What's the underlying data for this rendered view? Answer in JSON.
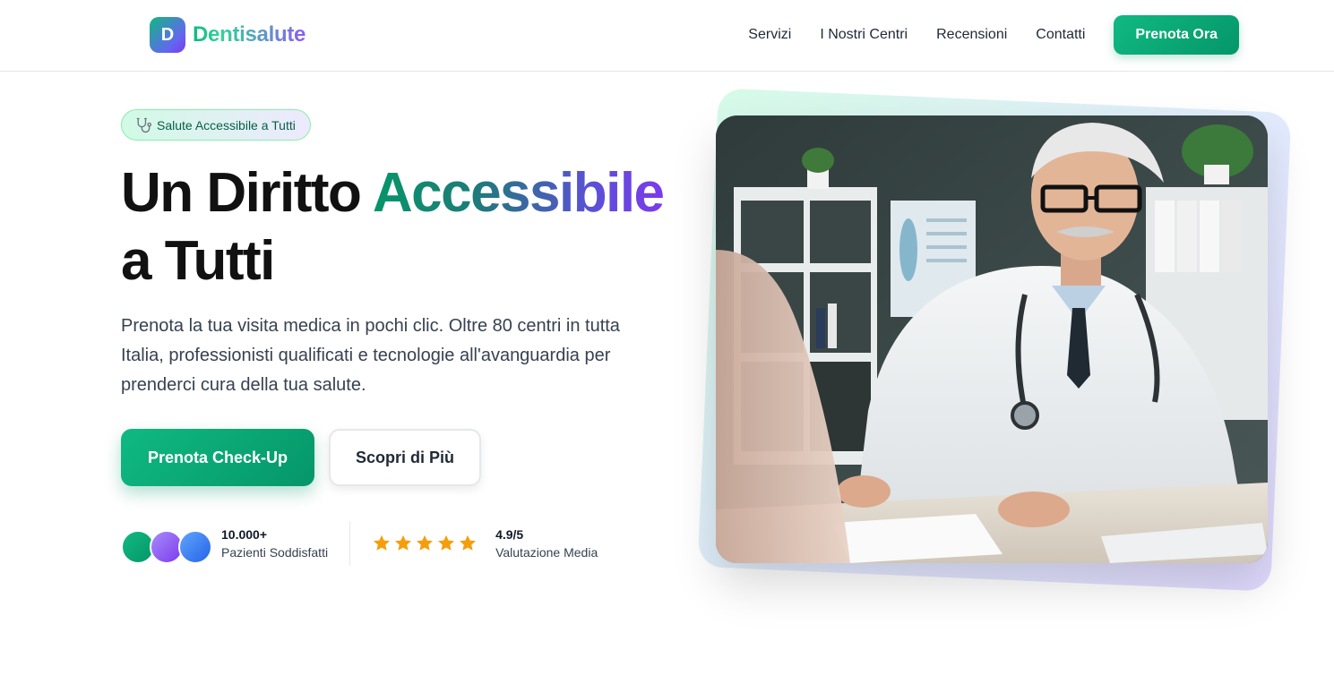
{
  "brand": {
    "logo_letter": "D",
    "name": "Dentisalute"
  },
  "nav": {
    "links": [
      "Servizi",
      "I Nostri Centri",
      "Recensioni",
      "Contatti"
    ],
    "cta": "Prenota Ora"
  },
  "hero": {
    "badge": "Salute Accessibile a Tutti",
    "badge_icon": "stethoscope-icon",
    "title_part1": "Un Diritto ",
    "title_highlight": "Accessibile",
    "title_part2": "a Tutti",
    "description": "Prenota la tua visita medica in pochi clic. Oltre 80 centri in tutta Italia, professionisti qualificati e tecnologie all'avanguardia per prenderci cura della tua salute.",
    "primary_button": "Prenota Check-Up",
    "secondary_button": "Scopri di Più"
  },
  "stats": {
    "patients_count": "10.000+",
    "patients_label": "Pazienti Soddisfatti",
    "rating_value": "4.9/5",
    "rating_label": "Valutazione Media",
    "stars": 5
  },
  "image": {
    "subject": "doctor-photo"
  },
  "colors": {
    "primary": "#10b981",
    "primary_dark": "#059669",
    "accent": "#7c3aed",
    "star": "#f59e0b",
    "text": "#111827"
  }
}
